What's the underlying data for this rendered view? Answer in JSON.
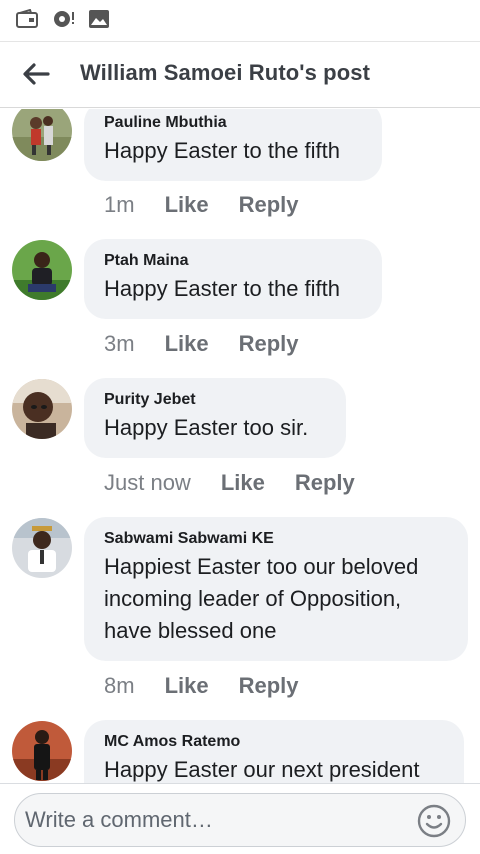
{
  "status_bar": {
    "icons": [
      "wallet-icon",
      "disc-notification-icon",
      "gallery-icon"
    ]
  },
  "header": {
    "back_icon": "arrow-left-icon",
    "title": "William Samoei Ruto's post"
  },
  "comments": [
    {
      "author": "Pauline Mbuthia",
      "lines": [
        "Happy Easter to the fifth"
      ],
      "time": "1m",
      "like_label": "Like",
      "reply_label": "Reply"
    },
    {
      "author": "Ptah Maina",
      "lines": [
        "Happy Easter to the fifth"
      ],
      "time": "3m",
      "like_label": "Like",
      "reply_label": "Reply"
    },
    {
      "author": "Purity Jebet",
      "lines": [
        "Happy Easter too sir."
      ],
      "time": "Just now",
      "like_label": "Like",
      "reply_label": "Reply"
    },
    {
      "author": "Sabwami Sabwami KE",
      "lines": [
        "Happiest Easter too our beloved",
        "incoming leader of Opposition,",
        "have blessed one"
      ],
      "time": "8m",
      "like_label": "Like",
      "reply_label": "Reply"
    },
    {
      "author": "MC Amos Ratemo",
      "lines": [
        "Happy Easter our next president"
      ]
    }
  ],
  "composer": {
    "placeholder": "Write a comment…",
    "emoji_icon": "smiley-icon"
  },
  "colors": {
    "bubble": "#f0f2f5",
    "title": "#3b3f45",
    "action": "#6b6f75"
  }
}
